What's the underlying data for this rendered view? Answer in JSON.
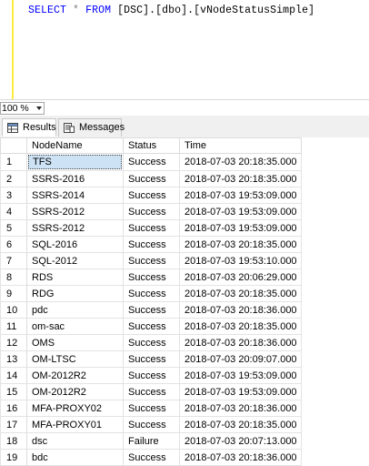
{
  "editor": {
    "sql_select": "SELECT",
    "sql_star": "*",
    "sql_from": "FROM",
    "sql_target": "[DSC].[dbo].[vNodeStatusSimple]"
  },
  "zoom": {
    "value": "100 %"
  },
  "tabs": [
    {
      "label": "Results",
      "icon": "grid-icon",
      "active": true
    },
    {
      "label": "Messages",
      "icon": "messages-icon",
      "active": false
    }
  ],
  "grid": {
    "columns": [
      "NodeName",
      "Status",
      "Time"
    ],
    "rows": [
      [
        "1",
        "TFS",
        "Success",
        "2018-07-03 20:18:35.000"
      ],
      [
        "2",
        "SSRS-2016",
        "Success",
        "2018-07-03 20:18:35.000"
      ],
      [
        "3",
        "SSRS-2014",
        "Success",
        "2018-07-03 19:53:09.000"
      ],
      [
        "4",
        "SSRS-2012",
        "Success",
        "2018-07-03 19:53:09.000"
      ],
      [
        "5",
        "SSRS-2012",
        "Success",
        "2018-07-03 19:53:09.000"
      ],
      [
        "6",
        "SQL-2016",
        "Success",
        "2018-07-03 20:18:35.000"
      ],
      [
        "7",
        "SQL-2012",
        "Success",
        "2018-07-03 19:53:10.000"
      ],
      [
        "8",
        "RDS",
        "Success",
        "2018-07-03 20:06:29.000"
      ],
      [
        "9",
        "RDG",
        "Success",
        "2018-07-03 20:18:35.000"
      ],
      [
        "10",
        "pdc",
        "Success",
        "2018-07-03 20:18:36.000"
      ],
      [
        "11",
        "om-sac",
        "Success",
        "2018-07-03 20:18:35.000"
      ],
      [
        "12",
        "OMS",
        "Success",
        "2018-07-03 20:18:36.000"
      ],
      [
        "13",
        "OM-LTSC",
        "Success",
        "2018-07-03 20:09:07.000"
      ],
      [
        "14",
        "OM-2012R2",
        "Success",
        "2018-07-03 19:53:09.000"
      ],
      [
        "15",
        "OM-2012R2",
        "Success",
        "2018-07-03 19:53:09.000"
      ],
      [
        "16",
        "MFA-PROXY02",
        "Success",
        "2018-07-03 20:18:36.000"
      ],
      [
        "17",
        "MFA-PROXY01",
        "Success",
        "2018-07-03 20:18:35.000"
      ],
      [
        "18",
        "dsc",
        "Failure",
        "2018-07-03 20:07:13.000"
      ],
      [
        "19",
        "bdc",
        "Success",
        "2018-07-03 20:18:36.000"
      ]
    ]
  }
}
